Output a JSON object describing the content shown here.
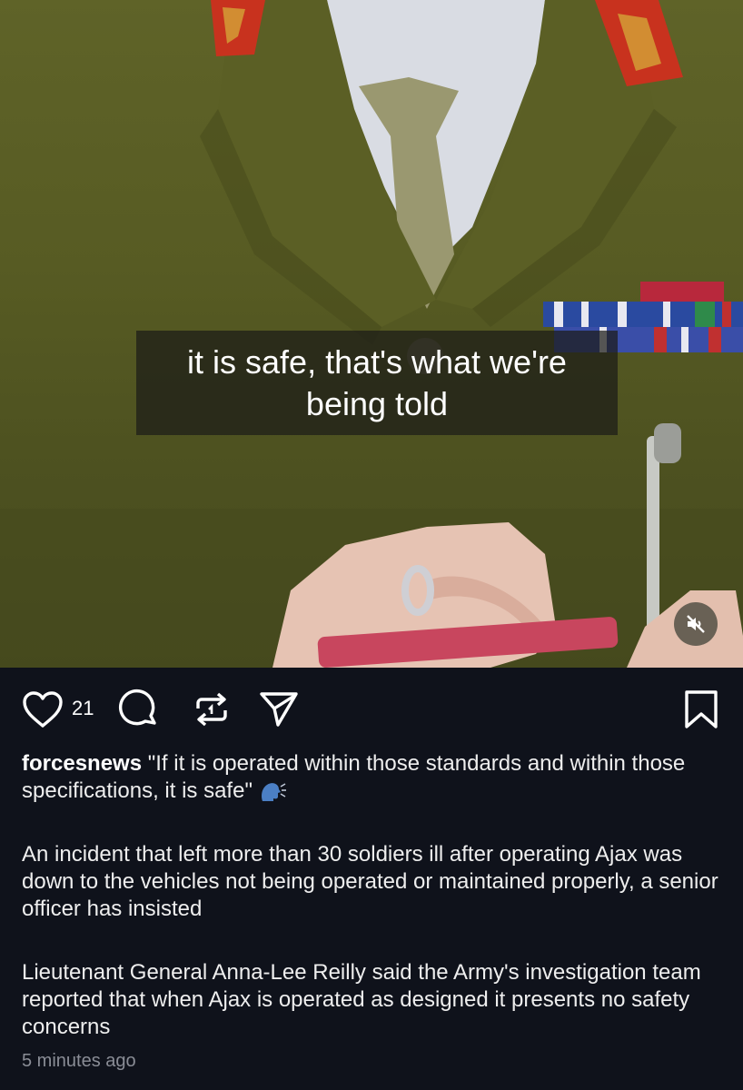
{
  "video": {
    "subtitle_line1": "it is safe, that's what we're",
    "subtitle_line2": "being told",
    "mute_icon": "speaker-muted-icon"
  },
  "actions": {
    "like_count": "21",
    "icons": [
      "heart-icon",
      "comment-icon",
      "repost-icon",
      "share-icon",
      "bookmark-icon"
    ]
  },
  "post": {
    "username": "forcesnews",
    "caption": "\"If it is operated within those standards and within those specifications, it is safe\"",
    "caption_emoji_icon": "speaking-head-icon",
    "paragraph2": "An incident that left more than 30 soldiers ill after operating Ajax was down to the vehicles not being operated or maintained properly, a senior officer has insisted",
    "paragraph3": "Lieutenant General Anna-Lee Reilly said the Army's investigation team reported that when Ajax is operated as designed it presents no safety concerns",
    "timestamp": "5 minutes ago"
  },
  "colors": {
    "background": "#0f121b",
    "uniform": "#5a5e26",
    "epaulette": "#c8321e"
  }
}
